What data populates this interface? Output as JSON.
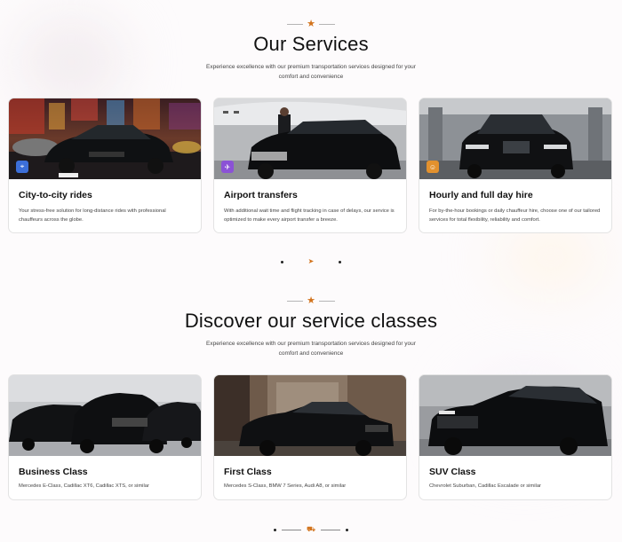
{
  "services": {
    "title": "Our Services",
    "subtitle": "Experience excellence with our premium transportation services designed for your comfort and convenience",
    "cards": [
      {
        "title": "City-to-city rides",
        "desc": "Your stress-free solution for long-distance rides with professional chauffeurs across the globe.",
        "icon": "location-pin-icon",
        "badge_color": "#3c6fd8"
      },
      {
        "title": "Airport transfers",
        "desc": "With additional wait time and flight tracking in case of delays, our service is optimized to make every airport transfer a breeze.",
        "icon": "plane-icon",
        "badge_color": "#8b52d6"
      },
      {
        "title": "Hourly and full day hire",
        "desc": "For by-the-hour bookings or daily chauffeur hire, choose one of our tailored services for total flexibility, reliability and comfort.",
        "icon": "person-icon",
        "badge_color": "#e2912e"
      }
    ]
  },
  "classes": {
    "title": "Discover our service classes",
    "subtitle": "Experience excellence with our premium transportation services designed for your comfort and convenience",
    "cards": [
      {
        "title": "Business Class",
        "desc": "Mercedes E-Class, Cadillac XT6, Cadillac XTS, or similar"
      },
      {
        "title": "First Class",
        "desc": "Mercedes S-Class, BMW 7 Series, Audi A8, or similar"
      },
      {
        "title": "SUV Class",
        "desc": "Chevrolet Suburban, Cadillac Escalade or similar"
      }
    ]
  },
  "colors": {
    "accent": "#d2731c"
  }
}
